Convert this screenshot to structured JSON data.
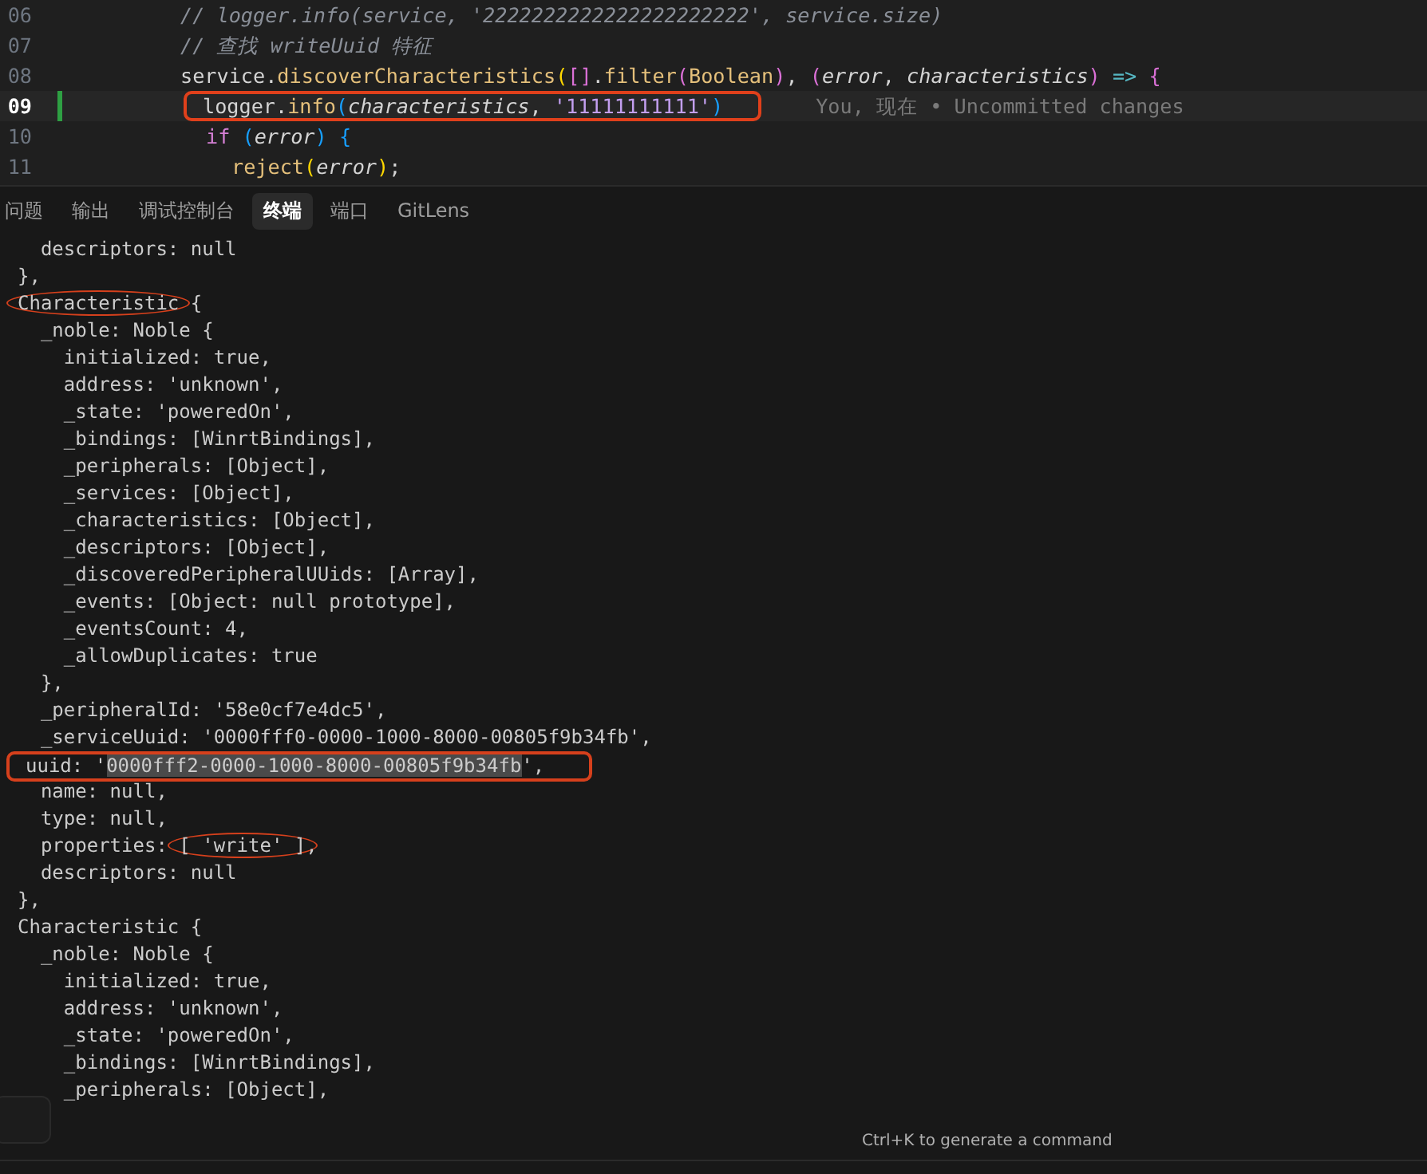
{
  "editor": {
    "lines": [
      {
        "number": "06",
        "current": false,
        "tokens": [
          {
            "text": "// logger.info(service, '2222222222222222222222', service.size)",
            "kind": "comment"
          }
        ]
      },
      {
        "number": "07",
        "current": false,
        "tokens": [
          {
            "text": "// 查找 writeUuid 特征",
            "kind": "comment"
          }
        ]
      },
      {
        "number": "08",
        "current": false,
        "tokens": [
          {
            "text": "service.",
            "kind": "plain"
          },
          {
            "text": "discoverCharacteristics",
            "kind": "fn"
          },
          {
            "text": "(",
            "kind": "b1"
          },
          {
            "text": "[]",
            "kind": "b2"
          },
          {
            "text": ".",
            "kind": "plain"
          },
          {
            "text": "filter",
            "kind": "fn"
          },
          {
            "text": "(",
            "kind": "b2"
          },
          {
            "text": "Boolean",
            "kind": "fn"
          },
          {
            "text": ")",
            "kind": "b2"
          },
          {
            "text": ", ",
            "kind": "plain"
          },
          {
            "text": "(",
            "kind": "b2"
          },
          {
            "text": "error",
            "kind": "param"
          },
          {
            "text": ", ",
            "kind": "plain"
          },
          {
            "text": "characteristics",
            "kind": "param"
          },
          {
            "text": ")",
            "kind": "b2"
          },
          {
            "text": " => ",
            "kind": "op"
          },
          {
            "text": "{",
            "kind": "b2"
          }
        ],
        "children": [
          {
            "number": "09",
            "current": true,
            "boxed": true,
            "tokens": [
              {
                "text": "logger.",
                "kind": "plain"
              },
              {
                "text": "info",
                "kind": "fn"
              },
              {
                "text": "(",
                "kind": "b3"
              },
              {
                "text": "characteristics",
                "kind": "param"
              },
              {
                "text": ", ",
                "kind": "plain"
              },
              {
                "text": "'11111111111'",
                "kind": "string"
              },
              {
                "text": ")",
                "kind": "b3"
              }
            ],
            "blame": "You, 现在 • Uncommitted changes"
          },
          {
            "number": "10",
            "current": false,
            "tokens": [
              {
                "text": "if ",
                "kind": "keyword"
              },
              {
                "text": "(",
                "kind": "b3"
              },
              {
                "text": "error",
                "kind": "param"
              },
              {
                "text": ")",
                "kind": "b3"
              },
              {
                "text": " {",
                "kind": "b3"
              }
            ],
            "children": [
              {
                "number": "11",
                "current": false,
                "tokens": [
                  {
                    "text": "reject",
                    "kind": "fn"
                  },
                  {
                    "text": "(",
                    "kind": "b1"
                  },
                  {
                    "text": "error",
                    "kind": "param"
                  },
                  {
                    "text": ")",
                    "kind": "b1"
                  },
                  {
                    "text": ";",
                    "kind": "plain"
                  }
                ]
              }
            ]
          }
        ]
      }
    ]
  },
  "panel_tabs": [
    {
      "label": "问题",
      "selected": false
    },
    {
      "label": "输出",
      "selected": false
    },
    {
      "label": "调试控制台",
      "selected": false
    },
    {
      "label": "终端",
      "selected": true
    },
    {
      "label": "端口",
      "selected": false
    },
    {
      "label": "GitLens",
      "selected": false
    }
  ],
  "terminal": {
    "lines": [
      {
        "parts": [
          {
            "text": "  descriptors: null"
          }
        ]
      },
      {
        "parts": [
          {
            "text": "},"
          }
        ]
      },
      {
        "parts": [
          {
            "text": "Characteristic",
            "circled": true
          },
          {
            "text": " {"
          }
        ]
      },
      {
        "parts": [
          {
            "text": "  _noble: Noble {"
          }
        ]
      },
      {
        "parts": [
          {
            "text": "    initialized: true,"
          }
        ]
      },
      {
        "parts": [
          {
            "text": "    address: 'unknown',"
          }
        ]
      },
      {
        "parts": [
          {
            "text": "    _state: 'poweredOn',"
          }
        ]
      },
      {
        "parts": [
          {
            "text": "    _bindings: [WinrtBindings],"
          }
        ]
      },
      {
        "parts": [
          {
            "text": "    _peripherals: [Object],"
          }
        ]
      },
      {
        "parts": [
          {
            "text": "    _services: [Object],"
          }
        ]
      },
      {
        "parts": [
          {
            "text": "    _characteristics: [Object],"
          }
        ]
      },
      {
        "parts": [
          {
            "text": "    _descriptors: [Object],"
          }
        ]
      },
      {
        "parts": [
          {
            "text": "    _discoveredPeripheralUUids: [Array],"
          }
        ]
      },
      {
        "parts": [
          {
            "text": "    _events: [Object: null prototype],"
          }
        ]
      },
      {
        "parts": [
          {
            "text": "    _eventsCount: 4,"
          }
        ]
      },
      {
        "parts": [
          {
            "text": "    _allowDuplicates: true"
          }
        ]
      },
      {
        "parts": [
          {
            "text": "  },"
          }
        ]
      },
      {
        "parts": [
          {
            "text": "  _peripheralId: '58e0cf7e4dc5',"
          }
        ]
      },
      {
        "parts": [
          {
            "text": "  _serviceUuid: '0000fff0-0000-1000-8000-00805f9b34fb',"
          }
        ]
      },
      {
        "boxed": true,
        "parts": [
          {
            "text": "uuid: '"
          },
          {
            "text": "0000fff2-0000-1000-8000-00805f9b34fb",
            "selected": true
          },
          {
            "text": "',"
          }
        ]
      },
      {
        "parts": [
          {
            "text": "  name: null,"
          }
        ]
      },
      {
        "parts": [
          {
            "text": "  type: null,"
          }
        ]
      },
      {
        "parts": [
          {
            "text": "  properties: "
          },
          {
            "text": "[ 'write' ]",
            "circled": true
          },
          {
            "text": ","
          }
        ]
      },
      {
        "parts": [
          {
            "text": "  descriptors: null"
          }
        ]
      },
      {
        "parts": [
          {
            "text": "},"
          }
        ]
      },
      {
        "parts": [
          {
            "text": "Characteristic {"
          }
        ]
      },
      {
        "parts": [
          {
            "text": "  _noble: Noble {"
          }
        ]
      },
      {
        "parts": [
          {
            "text": "    initialized: true,"
          }
        ]
      },
      {
        "parts": [
          {
            "text": "    address: 'unknown',"
          }
        ]
      },
      {
        "parts": [
          {
            "text": "    _state: 'poweredOn',"
          }
        ]
      },
      {
        "parts": [
          {
            "text": "    _bindings: [WinrtBindings],"
          }
        ]
      },
      {
        "parts": [
          {
            "text": "    _peripherals: [Object],"
          }
        ]
      }
    ]
  },
  "hint": "Ctrl+K to generate a command"
}
